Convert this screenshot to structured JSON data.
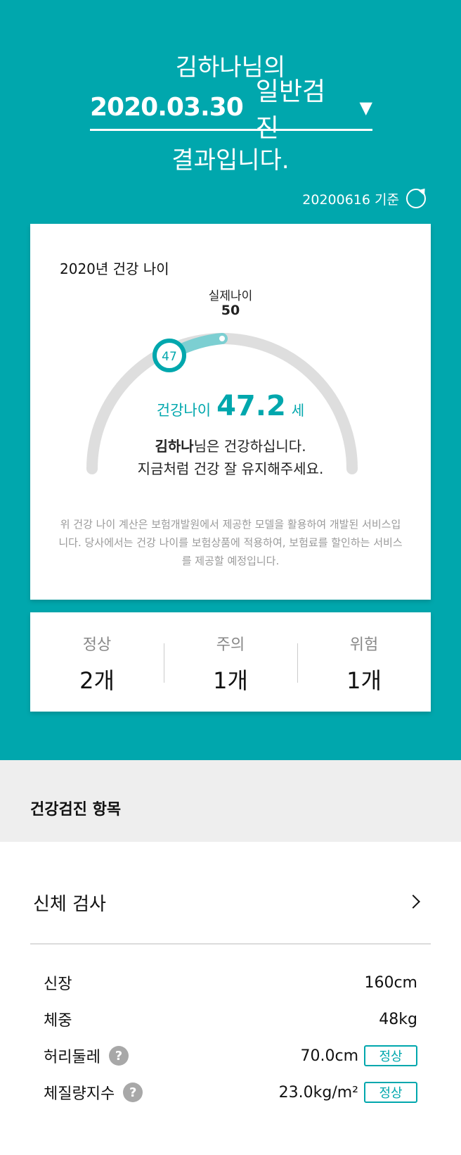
{
  "hero": {
    "name_line": "김하나님의",
    "date": "2020.03.30",
    "exam_type": "일반검진",
    "caret": "▼",
    "result_line": "결과입니다.",
    "basis_date": "20200616 기준"
  },
  "age_card": {
    "title": "2020년 건강 나이",
    "real_age_label": "실제나이",
    "real_age_value": "50",
    "marker_value": "47",
    "health_age_label": "건강나이",
    "health_age_value": "47.2",
    "health_age_unit": "세",
    "message_name": "김하나",
    "message_rest": "님은 건강하십니다.",
    "message_line2": "지금처럼 건강 잘 유지해주세요.",
    "note": "위 건강 나이 계산은 보험개발원에서 제공한 모델을 활용하여 개발된 서비스입니다. 당사에서는 건강 나이를 보험상품에 적용하여, 보험료를 할인하는 서비스를 제공할 예정입니다.",
    "colors": {
      "accent": "#00a7ad",
      "track": "#dedede",
      "range": "#7ccfd2"
    }
  },
  "counts": [
    {
      "label": "정상",
      "value": "2개"
    },
    {
      "label": "주의",
      "value": "1개"
    },
    {
      "label": "위험",
      "value": "1개"
    }
  ],
  "section": {
    "title": "건강검진 항목"
  },
  "body_exam": {
    "title": "신체 검사",
    "items": [
      {
        "name": "신장",
        "value": "160cm"
      },
      {
        "name": "체중",
        "value": "48kg"
      },
      {
        "name": "허리둘레",
        "help": "?",
        "value": "70.0cm",
        "badge": "정상"
      },
      {
        "name": "체질량지수",
        "help": "?",
        "value": "23.0kg/m²",
        "badge": "정상"
      }
    ]
  }
}
